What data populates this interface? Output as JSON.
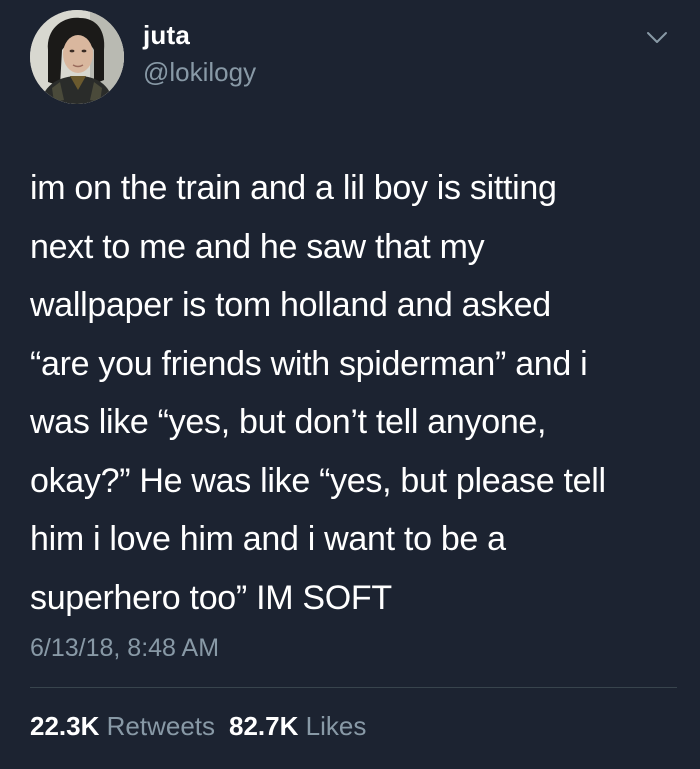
{
  "user": {
    "name": "juta",
    "handle": "@lokilogy"
  },
  "tweet": {
    "lines": [
      "im on the train and a lil boy is sitting",
      "next to me and he saw that my",
      "wallpaper is tom holland and asked",
      "“are you friends with spiderman” and i",
      "was like “yes, but don’t tell anyone,",
      "okay?” He was like “yes, but please tell",
      "him i love him and i want to be a",
      "superhero too” IM SOFT"
    ],
    "timestamp": "6/13/18, 8:48 AM"
  },
  "stats": {
    "retweets_count": "22.3K",
    "retweets_label": "Retweets",
    "likes_count": "82.7K",
    "likes_label": "Likes"
  },
  "icons": {
    "menu": "chevron-down-icon",
    "avatar": "profile-avatar"
  },
  "colors": {
    "background": "#1c2331",
    "primary_text": "#ffffff",
    "secondary_text": "#8899a6",
    "divider": "#38444d"
  }
}
